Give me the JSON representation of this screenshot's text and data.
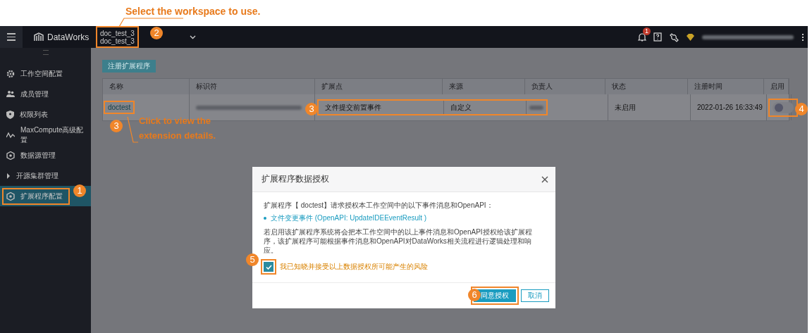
{
  "annotations": {
    "top_note": "Select the workspace to use.",
    "link_note": [
      "Click to view the",
      "extension details."
    ],
    "markers": [
      "1",
      "2",
      "3",
      "3",
      "4",
      "5",
      "6"
    ]
  },
  "topbar": {
    "brand": "DataWorks",
    "workspace": {
      "display_name": "doc_test_3",
      "name": "doc_test_3"
    },
    "notification_badge": "1"
  },
  "sidebar": {
    "items": [
      {
        "label": "工作空间配置",
        "kind": "link",
        "selected": false
      },
      {
        "label": "成员管理",
        "kind": "link",
        "selected": false
      },
      {
        "label": "权限列表",
        "kind": "link",
        "selected": false
      },
      {
        "label": "MaxCompute高级配置",
        "kind": "link",
        "selected": false
      },
      {
        "label": "数据源管理",
        "kind": "link",
        "selected": false
      },
      {
        "label": "开源集群管理",
        "kind": "group",
        "selected": false
      },
      {
        "label": "扩展程序配置",
        "kind": "link",
        "selected": true
      }
    ]
  },
  "content": {
    "register_button": "注册扩展程序",
    "table": {
      "columns": [
        "名称",
        "标识符",
        "扩展点",
        "来源",
        "负责人",
        "状态",
        "注册时间",
        "启用"
      ],
      "rows": [
        {
          "name": "doctest",
          "extension_point": "文件提交前置事件",
          "source": "自定义",
          "status": "未启用",
          "registered_at": "2022-01-26 16:33:49",
          "enabled": false
        }
      ]
    }
  },
  "dialog": {
    "title": "扩展程序数据授权",
    "intro": "扩展程序【 doctest】请求授权本工作空间中的以下事件消息和OpenAPI：",
    "events": [
      "文件变更事件 (OpenAPI: UpdateIDEEventResult )"
    ],
    "description": "若启用该扩展程序系统将会把本工作空间中的以上事件消息和OpenAPI授权给该扩展程序，该扩展程序可能根据事件消息和OpenAPI对DataWorks相关流程进行逻辑处理和响应。",
    "consent": {
      "label": "我已知晓并接受以上数据授权所可能产生的风险",
      "checked": true
    },
    "buttons": [
      {
        "label": "同意授权",
        "kind": "primary"
      },
      {
        "label": "取消",
        "kind": "secondary"
      }
    ]
  }
}
